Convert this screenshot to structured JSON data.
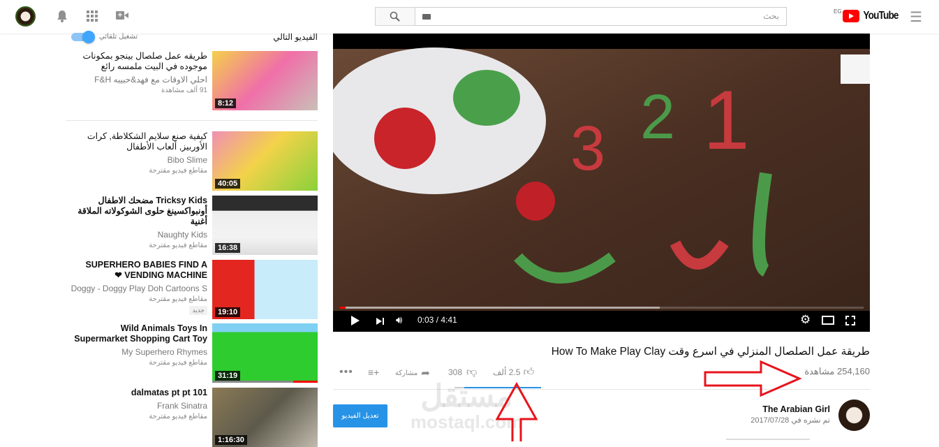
{
  "header": {
    "country_code": "EG",
    "logo_text": "YouTube",
    "search_placeholder": "بحث",
    "icons": [
      "menu-icon",
      "search-icon",
      "keyboard-icon",
      "video-camera-icon",
      "apps-icon",
      "bell-icon",
      "avatar"
    ]
  },
  "sidebar": {
    "up_next_label": "الفيديو التالي",
    "autoplay_label": "تشغيل تلقائي",
    "autoplay_on": true,
    "items": [
      {
        "title": "طريقه عمل صلصال بينجو بمكونات موجوده في البيت ملمسه رائع",
        "channel": "احلي الاوقات مع فهد&حبيبه F&H",
        "info": "91 ألف مشاهدة",
        "duration": "8:12",
        "badge": ""
      },
      {
        "title": "كيفية صنع سلايم الشكلاطة, كرات الأوربيز, ألعاب الأطفال",
        "channel": "Bibo Slime",
        "info": "مقاطع فيديو مقترحة",
        "duration": "40:05",
        "badge": ""
      },
      {
        "title": "Tricksy Kids مضحك الاطفال أونبواكسينغ حلوى الشوكولاته الملاقة أغنية",
        "channel": "Naughty Kids",
        "info": "مقاطع فيديو مقترحة",
        "duration": "16:38",
        "badge": ""
      },
      {
        "title": "SUPERHERO BABIES FIND A VENDING MACHINE ❤",
        "channel": "Doggy - Doggy Play Doh Cartoons S",
        "info": "مقاطع فيديو مقترحة",
        "duration": "19:10",
        "badge": "جديد"
      },
      {
        "title": "Wild Animals Toys In Supermarket Shopping Cart Toy",
        "channel": "My Superhero Rhymes",
        "info": "مقاطع فيديو مقترحة",
        "duration": "31:19",
        "badge": "",
        "watched_fraction": 0.23
      },
      {
        "title": "dalmatas pt pt 101",
        "channel": "Frank Sinatra",
        "info": "مقاطع فيديو مقترحة",
        "duration": "1:16:30",
        "badge": ""
      }
    ]
  },
  "player": {
    "time": "0:03 / 4:41",
    "played_fraction": 0.011,
    "buffered_fraction": 0.61
  },
  "video": {
    "title": "طريقة عمل الصلصال المنزلي في اسرع وقت How To Make Play Clay",
    "views": "254,160 مشاهدة",
    "likes": "2.5 ألف",
    "dislikes": "308",
    "like_fraction": 0.89,
    "share_label": "مشاركة",
    "channel_name": "The Arabian Girl",
    "published": "تم نشره في 2017/07/28",
    "edit_button": "تعديل الفيديو"
  },
  "watermark": {
    "arabic": "مستقل",
    "latin": "mostaql.com"
  },
  "colors": {
    "accent": "#065fd4",
    "brand_red": "#ff0000",
    "edit_button": "#2793e6",
    "annotation": "#e8141c"
  }
}
